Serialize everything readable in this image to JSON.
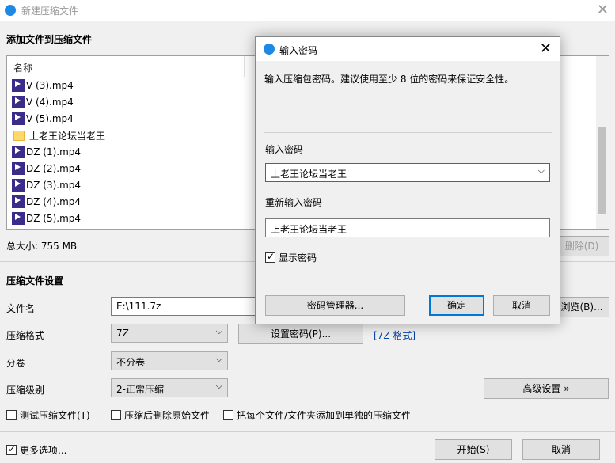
{
  "window": {
    "title": "新建压缩文件"
  },
  "files_section": {
    "heading": "添加文件到压缩文件",
    "column_name": "名称",
    "items": [
      {
        "name": "V (3).mp4",
        "type": "mp4"
      },
      {
        "name": "V (4).mp4",
        "type": "mp4"
      },
      {
        "name": "V (5).mp4",
        "type": "mp4"
      },
      {
        "name": "上老王论坛当老王",
        "type": "folder"
      },
      {
        "name": "DZ (1).mp4",
        "type": "mp4"
      },
      {
        "name": "DZ (2).mp4",
        "type": "mp4"
      },
      {
        "name": "DZ (3).mp4",
        "type": "mp4"
      },
      {
        "name": "DZ (4).mp4",
        "type": "mp4"
      },
      {
        "name": "DZ (5).mp4",
        "type": "mp4"
      }
    ],
    "total_size": "总大小: 755 MB",
    "delete_label": "删除(D)"
  },
  "settings": {
    "heading": "压缩文件设置",
    "filename_label": "文件名",
    "filename_value": "E:\\111.7z",
    "browse_label": "浏览(B)...",
    "format_label": "压缩格式",
    "format_value": "7Z",
    "set_password_label": "设置密码(P)...",
    "format_link": "[7Z 格式]",
    "split_label": "分卷",
    "split_value": "不分卷",
    "level_label": "压缩级别",
    "level_value": "2-正常压缩",
    "advanced_label": "高级设置 »",
    "test_label": "测试压缩文件(T)",
    "delete_after_label": "压缩后删除原始文件",
    "separate_label": "把每个文件/文件夹添加到单独的压缩文件"
  },
  "footer": {
    "more_options_label": "更多选项...",
    "start_label": "开始(S)",
    "cancel_label": "取消"
  },
  "dialog": {
    "title": "输入密码",
    "instruction": "输入压缩包密码。建议使用至少 8 位的密码来保证安全性。",
    "password_label": "输入密码",
    "password_value": "上老王论坛当老王",
    "reenter_label": "重新输入密码",
    "reenter_value": "上老王论坛当老王",
    "show_password_label": "显示密码",
    "manager_label": "密码管理器...",
    "ok_label": "确定",
    "cancel_label": "取消"
  }
}
